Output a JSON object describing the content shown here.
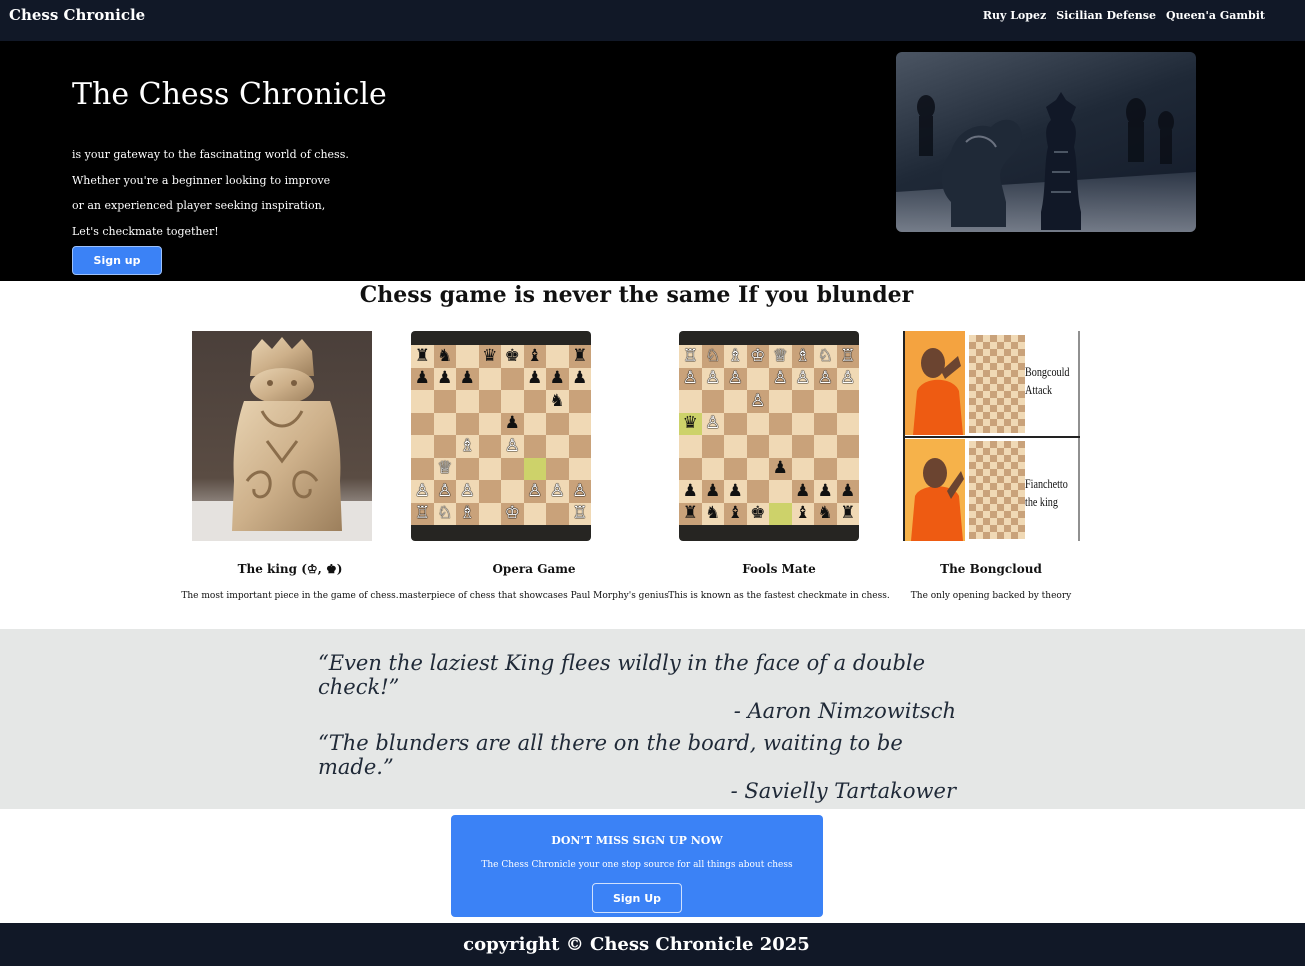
{
  "nav": {
    "brand": "Chess Chronicle",
    "links": [
      "Ruy Lopez",
      "Sicilian Defense",
      "Queen'a Gambit"
    ]
  },
  "hero": {
    "title": "The Chess Chronicle",
    "lines": [
      "is your gateway to the fascinating world of chess.",
      "Whether you're a beginner looking to improve",
      "or an experienced player seeking inspiration,",
      "Let's checkmate together!"
    ],
    "signup_label": "Sign up",
    "image": "chess-pieces-photo"
  },
  "section": {
    "heading": "Chess game is never the same If you blunder"
  },
  "cards": [
    {
      "title": "The king (♔, ♚)",
      "desc": "The most important piece in the game of chess.",
      "image": "lewis-chessman-king-photo"
    },
    {
      "title": "Opera Game",
      "desc": "masterpiece of chess that showcases Paul Morphy's genius",
      "image": "opera-game-board"
    },
    {
      "title": "Fools Mate",
      "desc": "This is known as the fastest checkmate in chess.",
      "image": "fools-mate-board"
    },
    {
      "title": "The Bongcloud",
      "desc": "The only opening backed by theory",
      "image": "bongcloud-meme",
      "meme_top": [
        "Bongcould",
        "Attack"
      ],
      "meme_bottom": [
        "Fianchetto",
        "the king"
      ]
    }
  ],
  "boards": {
    "opera": [
      "♜♞.♛♚♝.♜",
      "♟♟♟..♟♟♟",
      "......♞.",
      "....♟...",
      "..♗.♙...",
      ".♕.....hl",
      "♙♙♙..♙♙♙",
      "♖♘♗.♔..♖"
    ],
    "fools": [
      "♖♘♗♔♕♗♘♖",
      "♙♙♙.♙♙♙♙",
      "...♙....",
      "♛♙......",
      "........",
      "....♟...",
      "♟♟♟..♟♟♟",
      "♜♞♝♚.♝♞♜"
    ]
  },
  "quotes": [
    {
      "text": "“Even the laziest King flees wildly in the face of a double check!”",
      "author": "- Aaron Nimzowitsch"
    },
    {
      "text": "“The blunders are all there on the board, waiting to be made.”",
      "author": "- Savielly Tartakower"
    }
  ],
  "cta": {
    "title": "DON'T MISS SIGN UP NOW",
    "subtitle": "The Chess Chronicle your one stop source for all things about chess",
    "button_label": "Sign Up"
  },
  "footer": {
    "text": "copyright © Chess Chronicle 2025"
  },
  "colors": {
    "navbar": "#111827",
    "hero_bg": "#000000",
    "accent": "#3b82f6",
    "quotes_bg": "#e5e7e6"
  }
}
